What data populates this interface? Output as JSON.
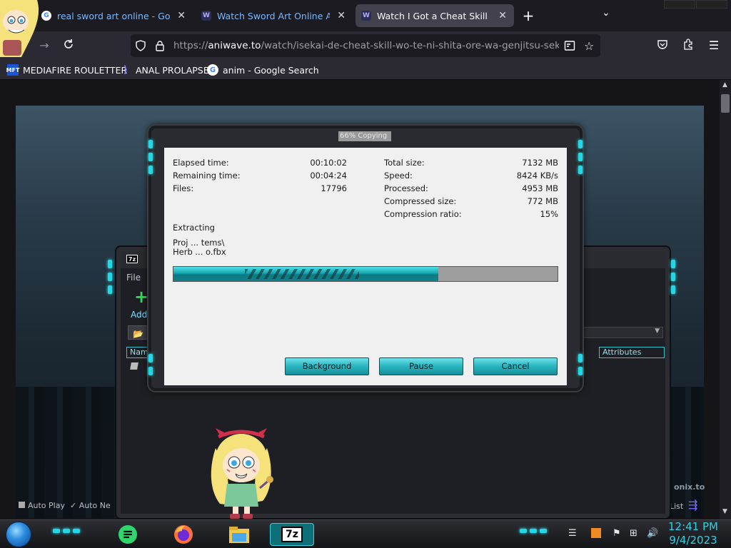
{
  "browser": {
    "tabs": [
      {
        "title": "real sword art online - Google Search",
        "favicon": "G",
        "active": false
      },
      {
        "title": "Watch Sword Art Online Anime Online",
        "favicon": "W",
        "active": false
      },
      {
        "title": "Watch I Got a Cheat Skill in Another World",
        "favicon": "W",
        "active": true
      }
    ],
    "new_tab": "+",
    "tab_list": "⌄",
    "url_prefix": "https://",
    "url_domain": "aniwave.to",
    "url_path": "/watch/isekai-de-cheat-skill-wo-te-ni-shita-ore-wa-genjitsu-sekai-wo-",
    "bookmarks": [
      {
        "label": "MEDIAFIRE ROULETTER",
        "icon": "MFT"
      },
      {
        "label": "ANAL PROLAPSE",
        "icon": "chevron-icon"
      },
      {
        "label": "anim - Google Search",
        "icon": "G"
      }
    ]
  },
  "page": {
    "auto_play": "Auto Play",
    "auto_next": "Auto Ne",
    "watermark": "onix.to",
    "list": "List"
  },
  "sevenzip_main": {
    "logo": "7z",
    "menu": "File",
    "add_label": "Add",
    "col_name": "Name",
    "col_attributes": "Attributes"
  },
  "progress_dialog": {
    "title": "66% Copying",
    "left_stats": [
      {
        "label": "Elapsed time:",
        "value": "00:10:02"
      },
      {
        "label": "Remaining time:",
        "value": "00:04:24"
      },
      {
        "label": "Files:",
        "value": "17796"
      }
    ],
    "right_stats": [
      {
        "label": "Total size:",
        "value": "7132 MB"
      },
      {
        "label": "Speed:",
        "value": "8424 KB/s"
      },
      {
        "label": "Processed:",
        "value": "4953 MB"
      },
      {
        "label": "Compressed size:",
        "value": "772 MB"
      },
      {
        "label": "Compression ratio:",
        "value": "15%"
      }
    ],
    "status": "Extracting",
    "path_line1": "Proj ... tems\\",
    "path_line2": "Herb ... o.fbx",
    "progress": 0.69,
    "buttons": {
      "background": "Background",
      "pause": "Pause",
      "cancel": "Cancel"
    }
  },
  "taskbar": {
    "apps": [
      "notes-icon",
      "firefox-icon",
      "files-icon",
      "7z-icon"
    ],
    "app_7z_label": "7z",
    "time": "12:41 PM",
    "date": "9/4/2023"
  },
  "colors": {
    "accent": "#26d6e6",
    "progress_fill": "#14a4ae",
    "clock": "#29d2e6"
  }
}
